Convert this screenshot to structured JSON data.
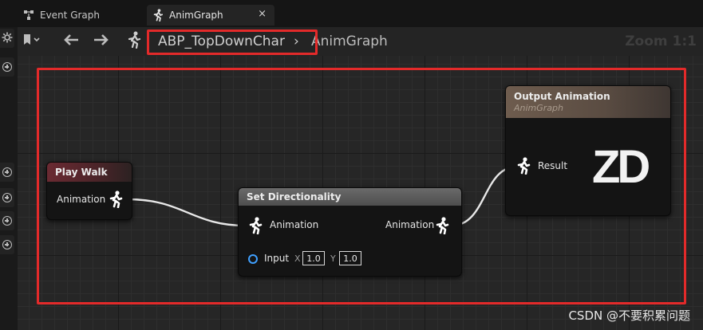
{
  "tabs": [
    {
      "label": "Event Graph",
      "icon": "event-graph-icon",
      "active": false
    },
    {
      "label": "AnimGraph",
      "icon": "running-man-icon",
      "active": true,
      "close": "×"
    }
  ],
  "toolbar": {
    "bookmark_icon": "bookmark-icon",
    "back_icon": "arrow-left-icon",
    "forward_icon": "arrow-right-icon",
    "breadcrumb": {
      "root": "ABP_TopDownChar",
      "separator": "›",
      "current": "AnimGraph"
    },
    "zoom": "Zoom 1:1"
  },
  "nodes": {
    "play_walk": {
      "title": "Play Walk",
      "output_pin": "Animation"
    },
    "set_directionality": {
      "title": "Set Directionality",
      "input_pin": "Animation",
      "output_pin": "Animation",
      "exec_pin": "Input",
      "x_label": "X",
      "x_value": "1.0",
      "y_label": "Y",
      "y_value": "1.0"
    },
    "output_animation": {
      "title": "Output Animation",
      "subtitle": "AnimGraph",
      "result_pin": "Result",
      "logo": "ZD"
    }
  },
  "watermark": "CSDN @不要积累问题",
  "colors": {
    "highlight": "#e32a2a",
    "exec_pin": "#3fa0ff",
    "wire": "#e8e8e8"
  }
}
